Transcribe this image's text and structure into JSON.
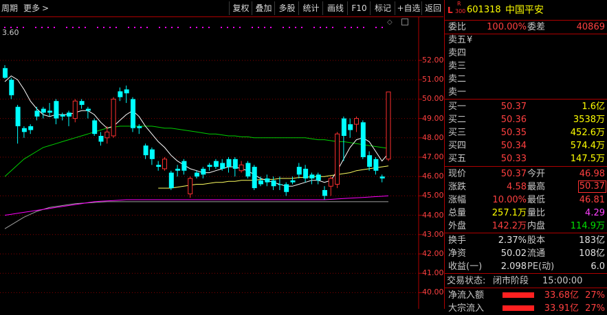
{
  "toolbar": {
    "period": "周期",
    "more": "更多",
    "buttons": [
      "复权",
      "叠加",
      "多股",
      "统计",
      "画线",
      "F10",
      "标记",
      "+自选",
      "返回"
    ]
  },
  "chart": {
    "top_label": "3.60",
    "y_ticks": [
      "52.00",
      "51.00",
      "50.00",
      "49.00",
      "48.00",
      "47.00",
      "46.00",
      "45.00",
      "44.00",
      "43.00",
      "42.00",
      "41.00",
      "40.00"
    ]
  },
  "chart_data": {
    "type": "candlestick",
    "ylim": [
      40.0,
      52.7
    ],
    "candles": [
      {
        "o": 51.1,
        "c": 51.6,
        "h": 51.75,
        "l": 51.05,
        "up": false
      },
      {
        "o": 51.0,
        "c": 50.2,
        "h": 51.1,
        "l": 50.0,
        "up": false
      },
      {
        "o": 49.6,
        "c": 48.6,
        "h": 49.7,
        "l": 47.7,
        "up": false
      },
      {
        "o": 48.5,
        "c": 48.3,
        "h": 48.6,
        "l": 48.0,
        "up": false
      },
      {
        "o": 48.4,
        "c": 48.6,
        "h": 48.7,
        "l": 48.2,
        "up": false
      },
      {
        "o": 49.4,
        "c": 49.1,
        "h": 49.6,
        "l": 48.9,
        "up": false
      },
      {
        "o": 49.5,
        "c": 49.3,
        "h": 49.6,
        "l": 49.0,
        "up": false
      },
      {
        "o": 49.3,
        "c": 49.4,
        "h": 49.8,
        "l": 49.1,
        "up": false
      },
      {
        "o": 49.9,
        "c": 49.0,
        "h": 50.0,
        "l": 48.7,
        "up": false
      },
      {
        "o": 49.2,
        "c": 49.1,
        "h": 49.3,
        "l": 48.9,
        "up": false
      },
      {
        "o": 49.1,
        "c": 49.3,
        "h": 49.4,
        "l": 48.6,
        "up": false
      },
      {
        "o": 49.0,
        "c": 49.9,
        "h": 50.0,
        "l": 48.8,
        "up": true
      },
      {
        "o": 49.7,
        "c": 49.9,
        "h": 50.0,
        "l": 49.5,
        "up": false
      },
      {
        "o": 49.5,
        "c": 49.4,
        "h": 49.6,
        "l": 49.0,
        "up": false
      },
      {
        "o": 48.9,
        "c": 48.2,
        "h": 49.0,
        "l": 48.1,
        "up": false
      },
      {
        "o": 48.1,
        "c": 47.8,
        "h": 48.3,
        "l": 47.6,
        "up": false
      },
      {
        "o": 48.3,
        "c": 48.0,
        "h": 48.6,
        "l": 47.7,
        "up": true
      },
      {
        "o": 48.1,
        "c": 50.0,
        "h": 50.1,
        "l": 48.0,
        "up": true
      },
      {
        "o": 50.1,
        "c": 50.4,
        "h": 50.6,
        "l": 49.9,
        "up": false
      },
      {
        "o": 50.3,
        "c": 50.5,
        "h": 50.7,
        "l": 49.8,
        "up": false
      },
      {
        "o": 50.0,
        "c": 48.5,
        "h": 50.1,
        "l": 48.3,
        "up": false
      },
      {
        "o": 48.6,
        "c": 48.5,
        "h": 48.7,
        "l": 48.2,
        "up": false
      },
      {
        "o": 47.6,
        "c": 47.1,
        "h": 47.7,
        "l": 46.9,
        "up": false
      },
      {
        "o": 47.4,
        "c": 46.9,
        "h": 47.5,
        "l": 46.6,
        "up": false
      },
      {
        "o": 46.6,
        "c": 46.5,
        "h": 46.8,
        "l": 46.3,
        "up": false
      },
      {
        "o": 46.4,
        "c": 46.9,
        "h": 47.0,
        "l": 46.3,
        "up": true
      },
      {
        "o": 46.2,
        "c": 45.4,
        "h": 46.3,
        "l": 45.3,
        "up": false
      },
      {
        "o": 46.3,
        "c": 46.4,
        "h": 46.6,
        "l": 46.0,
        "up": false
      },
      {
        "o": 46.3,
        "c": 46.8,
        "h": 46.9,
        "l": 46.1,
        "up": false
      },
      {
        "o": 45.9,
        "c": 45.1,
        "h": 46.0,
        "l": 44.9,
        "up": true
      },
      {
        "o": 46.2,
        "c": 46.0,
        "h": 46.3,
        "l": 45.9,
        "up": false
      },
      {
        "o": 46.4,
        "c": 46.1,
        "h": 46.5,
        "l": 45.9,
        "up": false
      },
      {
        "o": 46.5,
        "c": 46.6,
        "h": 46.7,
        "l": 46.3,
        "up": false
      },
      {
        "o": 46.8,
        "c": 46.5,
        "h": 46.9,
        "l": 46.4,
        "up": false
      },
      {
        "o": 46.4,
        "c": 46.7,
        "h": 46.9,
        "l": 46.3,
        "up": false
      },
      {
        "o": 46.9,
        "c": 46.5,
        "h": 47.0,
        "l": 46.2,
        "up": false
      },
      {
        "o": 46.9,
        "c": 46.4,
        "h": 47.0,
        "l": 46.0,
        "up": false
      },
      {
        "o": 46.6,
        "c": 46.3,
        "h": 46.8,
        "l": 46.2,
        "up": true
      },
      {
        "o": 46.7,
        "c": 46.0,
        "h": 46.8,
        "l": 45.9,
        "up": false
      },
      {
        "o": 46.5,
        "c": 45.4,
        "h": 46.6,
        "l": 45.3,
        "up": false
      },
      {
        "o": 45.8,
        "c": 45.6,
        "h": 46.0,
        "l": 45.5,
        "up": false
      },
      {
        "o": 45.7,
        "c": 45.9,
        "h": 46.1,
        "l": 45.5,
        "up": false
      },
      {
        "o": 45.8,
        "c": 45.5,
        "h": 46.0,
        "l": 45.3,
        "up": false
      },
      {
        "o": 45.6,
        "c": 45.6,
        "h": 46.0,
        "l": 45.3,
        "up": false
      },
      {
        "o": 45.6,
        "c": 45.2,
        "h": 45.7,
        "l": 45.0,
        "up": false
      },
      {
        "o": 45.8,
        "c": 45.7,
        "h": 46.0,
        "l": 45.6,
        "up": false
      },
      {
        "o": 46.5,
        "c": 46.1,
        "h": 46.7,
        "l": 45.9,
        "up": false
      },
      {
        "o": 46.4,
        "c": 45.9,
        "h": 46.6,
        "l": 45.7,
        "up": false
      },
      {
        "o": 46.1,
        "c": 45.9,
        "h": 46.2,
        "l": 45.6,
        "up": false
      },
      {
        "o": 46.1,
        "c": 45.8,
        "h": 46.2,
        "l": 45.6,
        "up": false
      },
      {
        "o": 45.3,
        "c": 45.0,
        "h": 45.5,
        "l": 44.8,
        "up": false
      },
      {
        "o": 45.5,
        "c": 45.9,
        "h": 46.0,
        "l": 45.0,
        "up": true
      },
      {
        "o": 45.6,
        "c": 48.2,
        "h": 48.3,
        "l": 45.4,
        "up": true
      },
      {
        "o": 49.0,
        "c": 48.1,
        "h": 49.1,
        "l": 46.8,
        "up": false
      },
      {
        "o": 48.7,
        "c": 48.4,
        "h": 49.0,
        "l": 48.0,
        "up": false
      },
      {
        "o": 48.7,
        "c": 49.0,
        "h": 49.1,
        "l": 48.3,
        "up": true
      },
      {
        "o": 48.8,
        "c": 47.0,
        "h": 48.9,
        "l": 46.9,
        "up": false
      },
      {
        "o": 47.1,
        "c": 46.5,
        "h": 47.3,
        "l": 46.3,
        "up": false
      },
      {
        "o": 46.9,
        "c": 46.3,
        "h": 47.0,
        "l": 46.1,
        "up": false
      },
      {
        "o": 46.0,
        "c": 45.9,
        "h": 46.1,
        "l": 45.7,
        "up": false
      },
      {
        "o": 46.9,
        "c": 50.37,
        "h": 50.37,
        "l": 46.8,
        "up": true
      }
    ],
    "ma_white": [
      50.9,
      51.2,
      51.0,
      50.5,
      49.9,
      49.5,
      49.2,
      49.1,
      49.2,
      49.2,
      49.2,
      49.3,
      49.4,
      49.4,
      49.2,
      48.8,
      48.5,
      48.6,
      48.9,
      49.2,
      49.4,
      49.1,
      48.6,
      48.2,
      47.8,
      47.5,
      47.1,
      46.8,
      46.6,
      46.4,
      46.3,
      46.2,
      46.2,
      46.3,
      46.4,
      46.5,
      46.5,
      46.4,
      46.3,
      46.1,
      45.9,
      45.8,
      45.7,
      45.6,
      45.5,
      45.5,
      45.6,
      45.7,
      45.8,
      45.8,
      45.7,
      45.8,
      46.3,
      46.9,
      47.5,
      47.9,
      48.0,
      47.8,
      47.3,
      46.8,
      47.2
    ],
    "ma_yellow": [
      null,
      null,
      null,
      null,
      null,
      null,
      null,
      null,
      null,
      null,
      null,
      null,
      null,
      null,
      null,
      null,
      null,
      null,
      null,
      null,
      null,
      null,
      null,
      null,
      45.4,
      45.4,
      45.4,
      45.45,
      45.5,
      45.55,
      45.6,
      45.6,
      45.65,
      45.7,
      45.7,
      45.75,
      45.75,
      45.8,
      45.8,
      45.8,
      45.85,
      45.85,
      45.85,
      45.9,
      45.9,
      45.9,
      45.95,
      45.95,
      46.0,
      46.0,
      46.0,
      46.05,
      46.1,
      46.15,
      46.2,
      46.3,
      46.35,
      46.4,
      46.45,
      46.5,
      46.55
    ],
    "ma_green": [
      46.0,
      46.3,
      46.6,
      46.9,
      47.1,
      47.3,
      47.5,
      47.6,
      47.7,
      47.8,
      47.9,
      48.0,
      48.1,
      48.2,
      48.3,
      48.4,
      48.5,
      48.55,
      48.6,
      48.6,
      48.6,
      48.6,
      48.6,
      48.6,
      48.55,
      48.5,
      48.5,
      48.45,
      48.4,
      48.35,
      48.3,
      48.25,
      48.2,
      48.2,
      48.15,
      48.1,
      48.1,
      48.05,
      48.05,
      48.0,
      48.0,
      48.0,
      48.0,
      48.0,
      48.0,
      48.0,
      48.0,
      48.0,
      47.95,
      47.9,
      47.9,
      47.85,
      47.8,
      47.8,
      47.75,
      47.7,
      47.65,
      47.6,
      47.55,
      47.5,
      47.45
    ],
    "ma_magenta": [
      44.0,
      44.05,
      44.1,
      44.15,
      44.2,
      44.25,
      44.3,
      44.35,
      44.4,
      44.45,
      44.5,
      44.55,
      44.6,
      44.65,
      44.7,
      44.72,
      44.74,
      44.76,
      44.78,
      44.8,
      44.8,
      44.8,
      44.8,
      44.8,
      44.8,
      44.8,
      44.8,
      44.8,
      44.8,
      44.8,
      44.8,
      44.8,
      44.8,
      44.8,
      44.8,
      44.8,
      44.8,
      44.8,
      44.8,
      44.8,
      44.8,
      44.8,
      44.8,
      44.8,
      44.8,
      44.8,
      44.8,
      44.8,
      44.8,
      44.8,
      44.8,
      44.82,
      44.84,
      44.86,
      44.88,
      44.9,
      44.92,
      44.94,
      44.96,
      44.98,
      45.0
    ],
    "ma_gray": [
      43.3,
      43.5,
      43.7,
      43.9,
      44.05,
      44.2,
      44.3,
      44.4,
      44.45,
      44.5,
      44.55,
      44.6,
      44.62,
      44.64,
      44.66,
      44.68,
      44.7,
      44.7,
      44.7,
      44.7,
      44.7,
      44.7,
      44.7,
      44.7,
      44.7,
      44.7,
      44.7,
      44.7,
      44.7,
      44.7,
      44.7,
      44.7,
      44.7,
      44.7,
      44.7,
      44.7,
      44.7,
      44.7,
      44.7,
      44.7,
      44.7,
      44.7,
      44.7,
      44.7,
      44.7,
      44.7,
      44.7,
      44.7,
      44.7,
      44.7,
      44.7,
      44.7,
      44.7,
      44.7,
      44.7,
      44.7,
      44.7,
      44.7,
      44.7,
      44.7,
      44.7
    ]
  },
  "panel": {
    "flag_l": "L",
    "flag_r": "R",
    "flag_300": "300",
    "code": "601318",
    "name": "中国平安",
    "weibi_label": "委比",
    "weibi_value": "100.00%",
    "weicha_label": "委差",
    "weicha_value": "40869",
    "asks": [
      {
        "label": "卖五",
        "extra": "¥"
      },
      {
        "label": "卖四",
        "extra": ""
      },
      {
        "label": "卖三",
        "extra": ""
      },
      {
        "label": "卖二",
        "extra": ""
      },
      {
        "label": "卖一",
        "extra": ""
      }
    ],
    "bids": [
      {
        "label": "买一",
        "price": "50.37",
        "vol": "1.6亿"
      },
      {
        "label": "买二",
        "price": "50.36",
        "vol": "3538万"
      },
      {
        "label": "买三",
        "price": "50.35",
        "vol": "452.6万"
      },
      {
        "label": "买四",
        "price": "50.34",
        "vol": "574.4万"
      },
      {
        "label": "买五",
        "price": "50.33",
        "vol": "147.5万"
      }
    ],
    "stats": [
      {
        "l1": "现价",
        "v1": "50.37",
        "l2": "今开",
        "v2": "46.98"
      },
      {
        "l1": "涨跌",
        "v1": "4.58",
        "l2": "最高",
        "v2": "50.37"
      },
      {
        "l1": "涨幅",
        "v1": "10.00%",
        "l2": "最低",
        "v2": "46.81"
      },
      {
        "l1": "总量",
        "v1": "257.1万",
        "l2": "量比",
        "v2": "4.29"
      },
      {
        "l1": "外盘",
        "v1": "142.2万",
        "l2": "内盘",
        "v2": "114.9万"
      }
    ],
    "stats2": [
      {
        "l1": "换手",
        "v1": "2.37%",
        "l2": "股本",
        "v2": "183亿"
      },
      {
        "l1": "净资",
        "v1": "50.02",
        "l2": "流通",
        "v2": "108亿"
      },
      {
        "l1": "收益(一)",
        "v1": "2.098",
        "l2": "PE(动)",
        "v2": "6.0"
      }
    ],
    "status_label": "交易状态:",
    "status_value": "闭市阶段",
    "status_time": "15:00:00",
    "flow": [
      {
        "label": "净流入额",
        "value": "33.68亿",
        "pct": "27%"
      },
      {
        "label": "大宗流入",
        "value": "33.91亿",
        "pct": "27%"
      }
    ]
  },
  "colors": {
    "up": "#ff3030",
    "down": "#00ffff",
    "ma_white": "#ffffff",
    "ma_yellow": "#ffff60",
    "ma_green": "#00d000",
    "ma_magenta": "#ff00ff",
    "ma_gray": "#a0a0a0",
    "grid": "#8b0000"
  }
}
